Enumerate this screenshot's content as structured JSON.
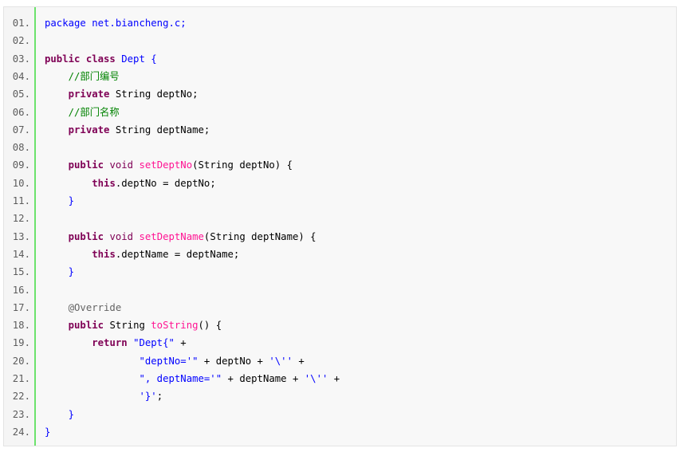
{
  "code_lines": [
    {
      "n": "01.",
      "parts": [
        {
          "t": "package net.biancheng.c;",
          "c": "str"
        }
      ]
    },
    {
      "n": "02.",
      "parts": []
    },
    {
      "n": "03.",
      "parts": [
        {
          "t": "public class",
          "c": "kw"
        },
        {
          "t": " Dept {",
          "c": "str"
        }
      ]
    },
    {
      "n": "04.",
      "parts": [
        {
          "t": "    ",
          "c": "plain"
        },
        {
          "t": "//部门编号",
          "c": "cmt"
        }
      ]
    },
    {
      "n": "05.",
      "parts": [
        {
          "t": "    ",
          "c": "plain"
        },
        {
          "t": "private",
          "c": "kw"
        },
        {
          "t": " String deptNo;",
          "c": "plain"
        }
      ]
    },
    {
      "n": "06.",
      "parts": [
        {
          "t": "    ",
          "c": "plain"
        },
        {
          "t": "//部门名称",
          "c": "cmt"
        }
      ]
    },
    {
      "n": "07.",
      "parts": [
        {
          "t": "    ",
          "c": "plain"
        },
        {
          "t": "private",
          "c": "kw"
        },
        {
          "t": " String deptName;",
          "c": "plain"
        }
      ]
    },
    {
      "n": "08.",
      "parts": []
    },
    {
      "n": "09.",
      "parts": [
        {
          "t": "    ",
          "c": "plain"
        },
        {
          "t": "public",
          "c": "kw"
        },
        {
          "t": " ",
          "c": "plain"
        },
        {
          "t": "void",
          "c": "type"
        },
        {
          "t": " ",
          "c": "plain"
        },
        {
          "t": "setDeptNo",
          "c": "fn"
        },
        {
          "t": "(String deptNo) {",
          "c": "plain"
        }
      ]
    },
    {
      "n": "10.",
      "parts": [
        {
          "t": "        ",
          "c": "plain"
        },
        {
          "t": "this",
          "c": "kw"
        },
        {
          "t": ".deptNo = deptNo;",
          "c": "plain"
        }
      ]
    },
    {
      "n": "11.",
      "parts": [
        {
          "t": "    }",
          "c": "str"
        }
      ]
    },
    {
      "n": "12.",
      "parts": []
    },
    {
      "n": "13.",
      "parts": [
        {
          "t": "    ",
          "c": "plain"
        },
        {
          "t": "public",
          "c": "kw"
        },
        {
          "t": " ",
          "c": "plain"
        },
        {
          "t": "void",
          "c": "type"
        },
        {
          "t": " ",
          "c": "plain"
        },
        {
          "t": "setDeptName",
          "c": "fn"
        },
        {
          "t": "(String deptName) {",
          "c": "plain"
        }
      ]
    },
    {
      "n": "14.",
      "parts": [
        {
          "t": "        ",
          "c": "plain"
        },
        {
          "t": "this",
          "c": "kw"
        },
        {
          "t": ".deptName = deptName;",
          "c": "plain"
        }
      ]
    },
    {
      "n": "15.",
      "parts": [
        {
          "t": "    }",
          "c": "str"
        }
      ]
    },
    {
      "n": "16.",
      "parts": []
    },
    {
      "n": "17.",
      "parts": [
        {
          "t": "    @Override",
          "c": "ann"
        }
      ]
    },
    {
      "n": "18.",
      "parts": [
        {
          "t": "    ",
          "c": "plain"
        },
        {
          "t": "public",
          "c": "kw"
        },
        {
          "t": " String ",
          "c": "plain"
        },
        {
          "t": "toString",
          "c": "fn"
        },
        {
          "t": "() {",
          "c": "plain"
        }
      ]
    },
    {
      "n": "19.",
      "parts": [
        {
          "t": "        ",
          "c": "plain"
        },
        {
          "t": "return",
          "c": "kw"
        },
        {
          "t": " ",
          "c": "plain"
        },
        {
          "t": "\"Dept{\"",
          "c": "str"
        },
        {
          "t": " +",
          "c": "plain"
        }
      ]
    },
    {
      "n": "20.",
      "parts": [
        {
          "t": "                ",
          "c": "plain"
        },
        {
          "t": "\"deptNo='\"",
          "c": "str"
        },
        {
          "t": " + deptNo + ",
          "c": "plain"
        },
        {
          "t": "'\\''",
          "c": "str"
        },
        {
          "t": " +",
          "c": "plain"
        }
      ]
    },
    {
      "n": "21.",
      "parts": [
        {
          "t": "                ",
          "c": "plain"
        },
        {
          "t": "\", deptName='\"",
          "c": "str"
        },
        {
          "t": " + deptName + ",
          "c": "plain"
        },
        {
          "t": "'\\''",
          "c": "str"
        },
        {
          "t": " +",
          "c": "plain"
        }
      ]
    },
    {
      "n": "22.",
      "parts": [
        {
          "t": "                ",
          "c": "plain"
        },
        {
          "t": "'}'",
          "c": "str"
        },
        {
          "t": ";",
          "c": "plain"
        }
      ]
    },
    {
      "n": "23.",
      "parts": [
        {
          "t": "    }",
          "c": "str"
        }
      ]
    },
    {
      "n": "24.",
      "parts": [
        {
          "t": "}",
          "c": "str"
        }
      ]
    }
  ]
}
